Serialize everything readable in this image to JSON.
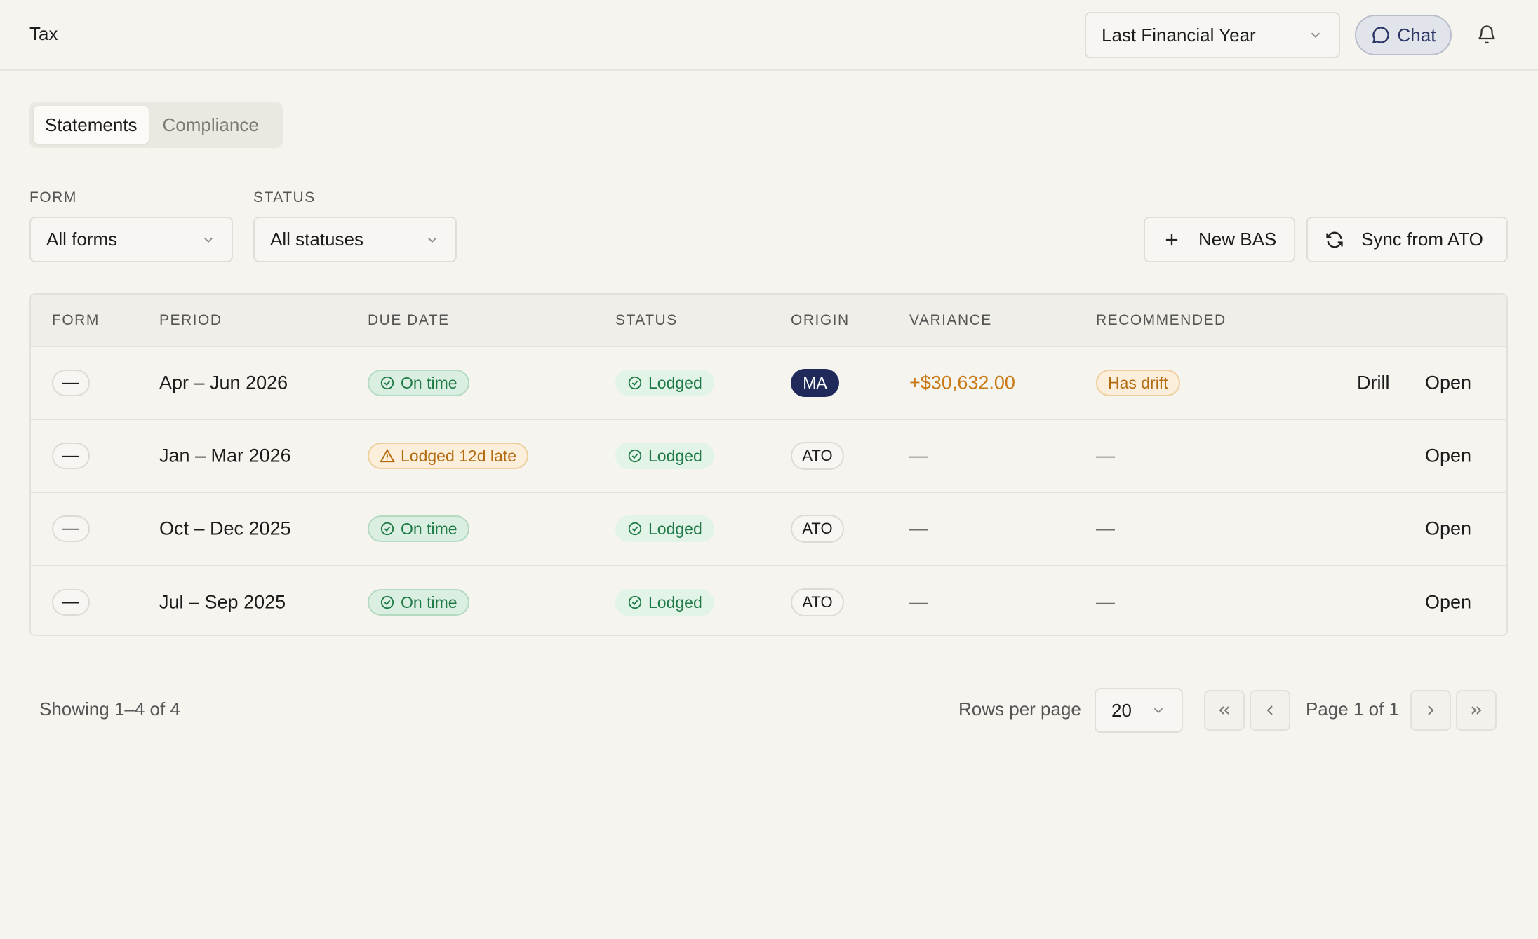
{
  "app": {
    "title": "Tax"
  },
  "header": {
    "period_select": "Last Financial Year",
    "chat_label": "Chat"
  },
  "tabs": [
    {
      "label": "Statements",
      "active": true
    },
    {
      "label": "Compliance",
      "active": false
    }
  ],
  "filters": {
    "form_label": "FORM",
    "form_value": "All forms",
    "status_label": "STATUS",
    "status_value": "All statuses"
  },
  "actions": {
    "new_bas": "New BAS",
    "sync": "Sync from ATO"
  },
  "table": {
    "headers": [
      "FORM",
      "PERIOD",
      "DUE DATE",
      "STATUS",
      "ORIGIN",
      "VARIANCE",
      "RECOMMENDED"
    ],
    "rows": [
      {
        "form": "—",
        "period": "Apr – Jun 2026",
        "due": "On time",
        "due_kind": "ok",
        "status": "Lodged",
        "origin": "MA",
        "variance": "+$30,632.00",
        "recommended": "Has drift",
        "drill": "Drill",
        "open": "Open"
      },
      {
        "form": "—",
        "period": "Jan – Mar 2026",
        "due": "Lodged 12d late",
        "due_kind": "late",
        "status": "Lodged",
        "origin": "ATO",
        "variance": "—",
        "recommended": "—",
        "drill": "",
        "open": "Open"
      },
      {
        "form": "—",
        "period": "Oct – Dec 2025",
        "due": "On time",
        "due_kind": "ok",
        "status": "Lodged",
        "origin": "ATO",
        "variance": "—",
        "recommended": "—",
        "drill": "",
        "open": "Open"
      },
      {
        "form": "—",
        "period": "Jul – Sep 2025",
        "due": "On time",
        "due_kind": "ok",
        "status": "Lodged",
        "origin": "ATO",
        "variance": "—",
        "recommended": "—",
        "drill": "",
        "open": "Open"
      }
    ]
  },
  "footer": {
    "showing": "Showing 1–4 of 4",
    "rows_per_page_label": "Rows per page",
    "rows_per_page_value": "20",
    "page_text": "Page 1 of 1"
  },
  "colors": {
    "accent_navy": "#1f2a5a",
    "ok_green": "#1e7a45",
    "warn_amber": "#c97a14"
  }
}
